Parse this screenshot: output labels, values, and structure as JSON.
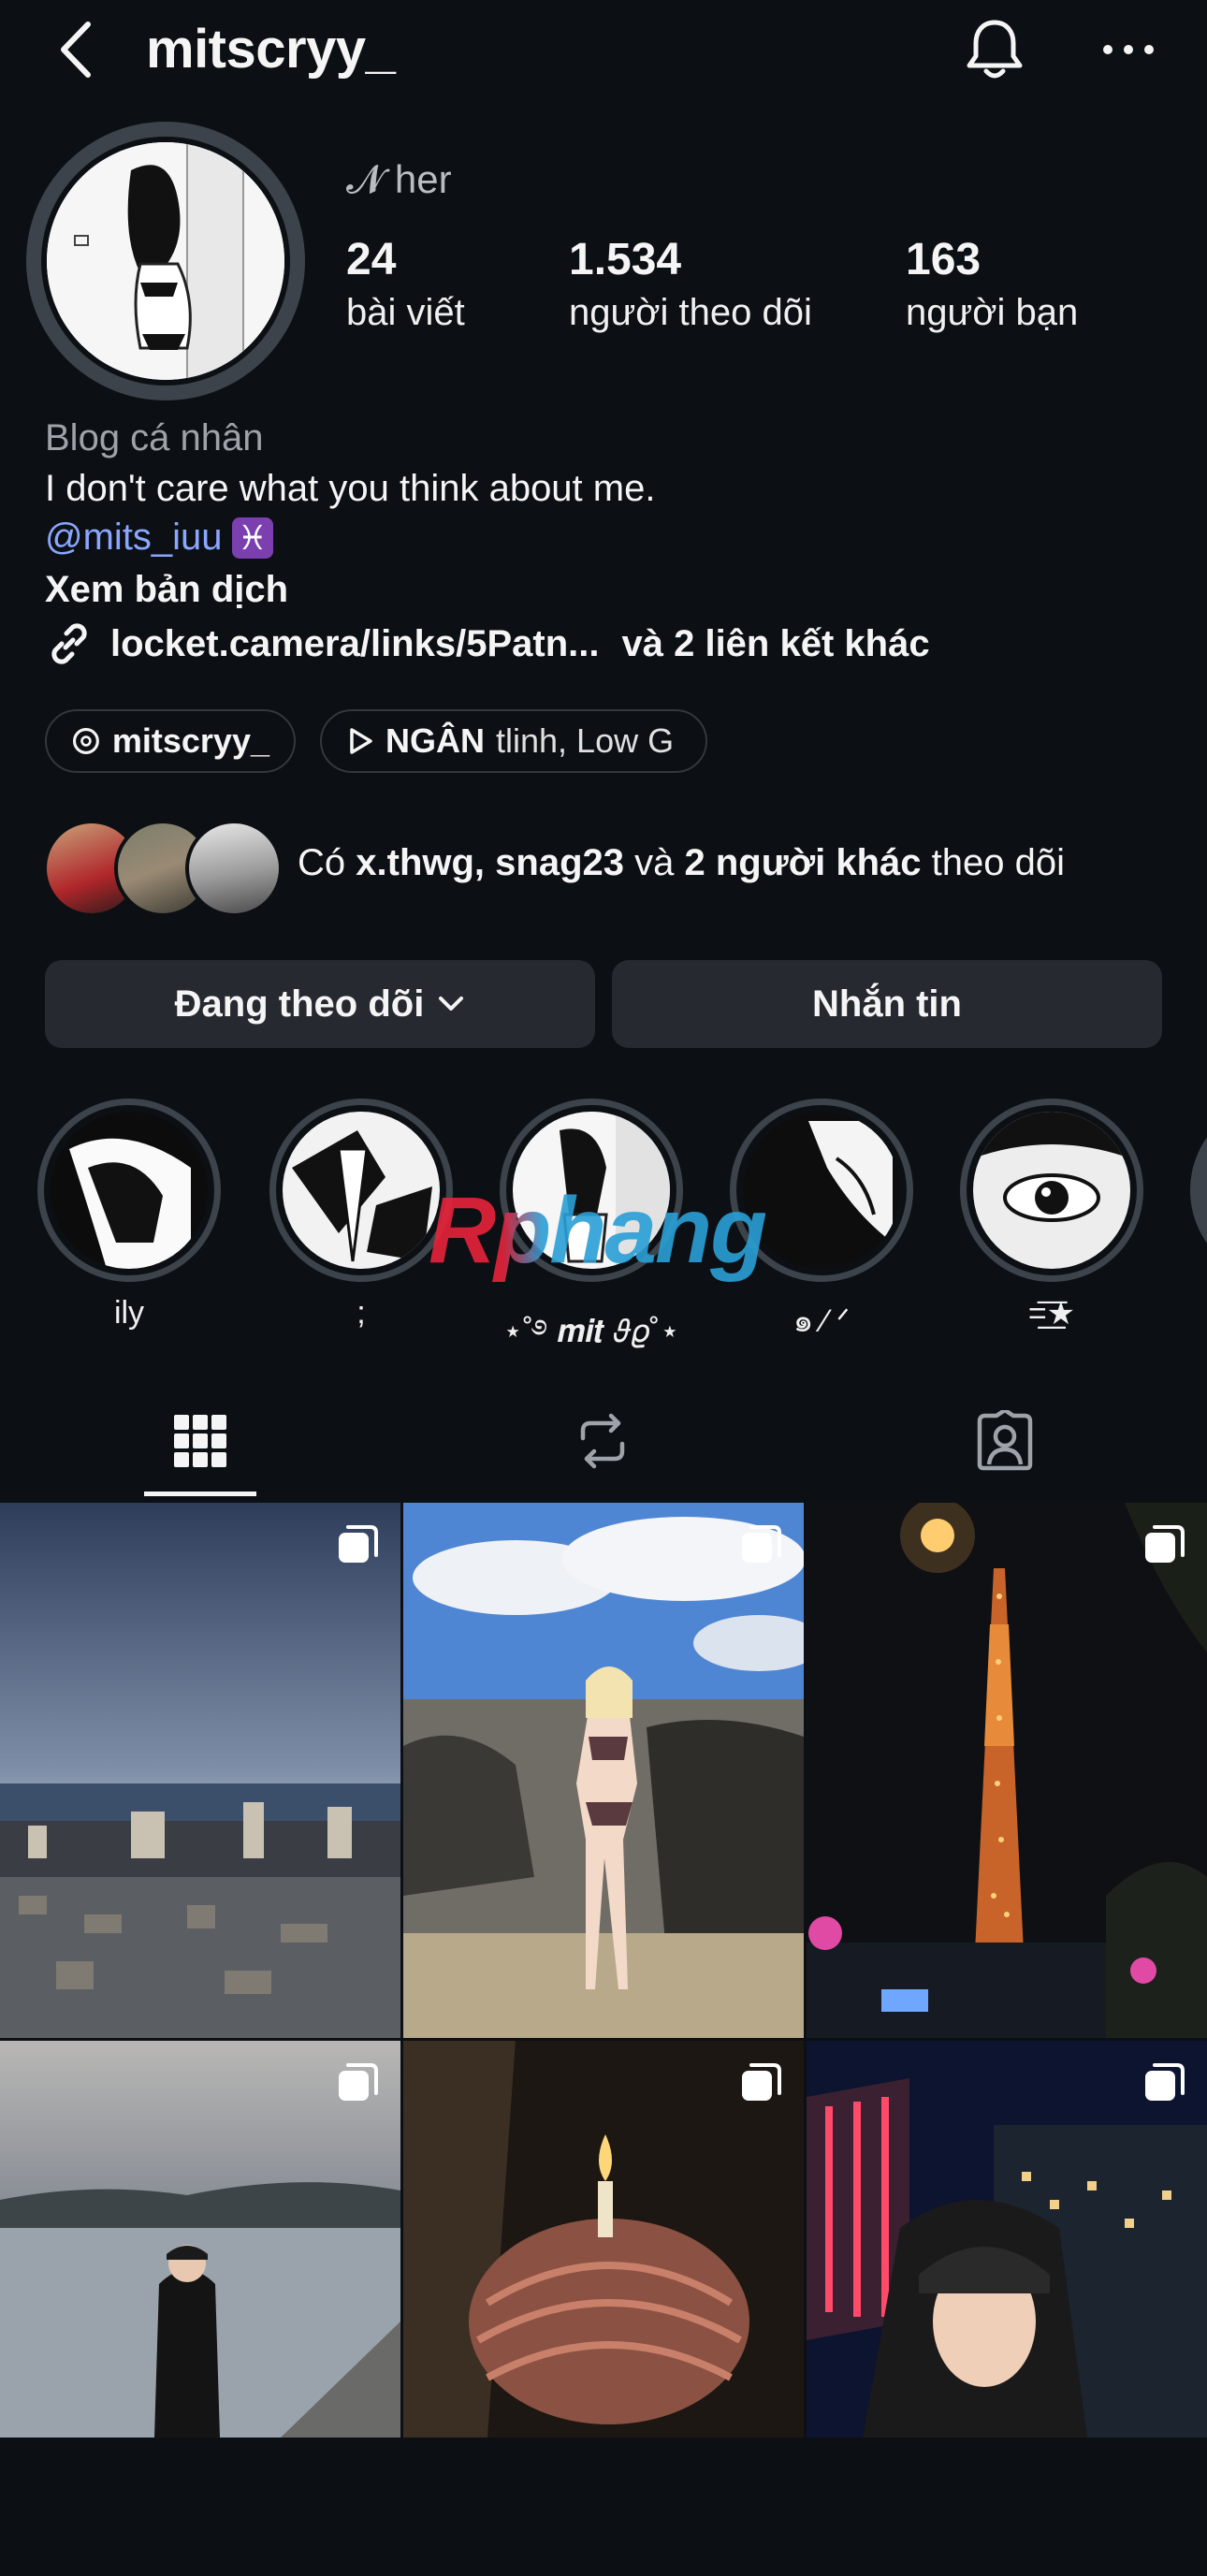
{
  "header": {
    "username": "mitscryy_",
    "back_icon": "chevron-left-icon",
    "notification_icon": "bell-icon",
    "more_icon": "more-horizontal-icon"
  },
  "profile": {
    "display_name": "𝓝 her",
    "stats": [
      {
        "count": "24",
        "label": "bài viết"
      },
      {
        "count": "1.534",
        "label": "người theo dõi"
      },
      {
        "count": "163",
        "label": "người bạn"
      }
    ]
  },
  "bio": {
    "category": "Blog cá nhân",
    "text": "I don't care what you think about me.",
    "mention": "@mits_iuu",
    "zodiac": "♓",
    "translate": "Xem bản dịch",
    "link_text": "locket.camera/links/5Patn...",
    "link_more": "và 2 liên kết khác"
  },
  "chips": {
    "threads": "mitscryy_",
    "music_title": "NGÂN",
    "music_artist": "tlinh, Low G"
  },
  "followed_by": {
    "prefix": "Có",
    "names": "x.thwg, snag23",
    "and": "và",
    "others": "2 người khác",
    "suffix": "theo dõi"
  },
  "buttons": {
    "following": "Đang theo dõi",
    "message": "Nhắn tin"
  },
  "highlights": [
    {
      "label": "ily"
    },
    {
      "label": ";"
    },
    {
      "label": "⋆˚࿔ 𝒎𝒊𝒕 𝜗𝜚˚⋆"
    },
    {
      "label": "๑ ⁄ ᐟ"
    },
    {
      "label": "=͟͟͞★"
    }
  ],
  "watermark": "Rphang",
  "tabs": [
    "grid-icon",
    "reels-repost-icon",
    "tagged-icon"
  ],
  "colors": {
    "background": "#0c1014",
    "button": "#262a30",
    "mention": "#8aa6ff",
    "watermark_red": "#e8233a",
    "watermark_blue": "#2a9fd6"
  }
}
